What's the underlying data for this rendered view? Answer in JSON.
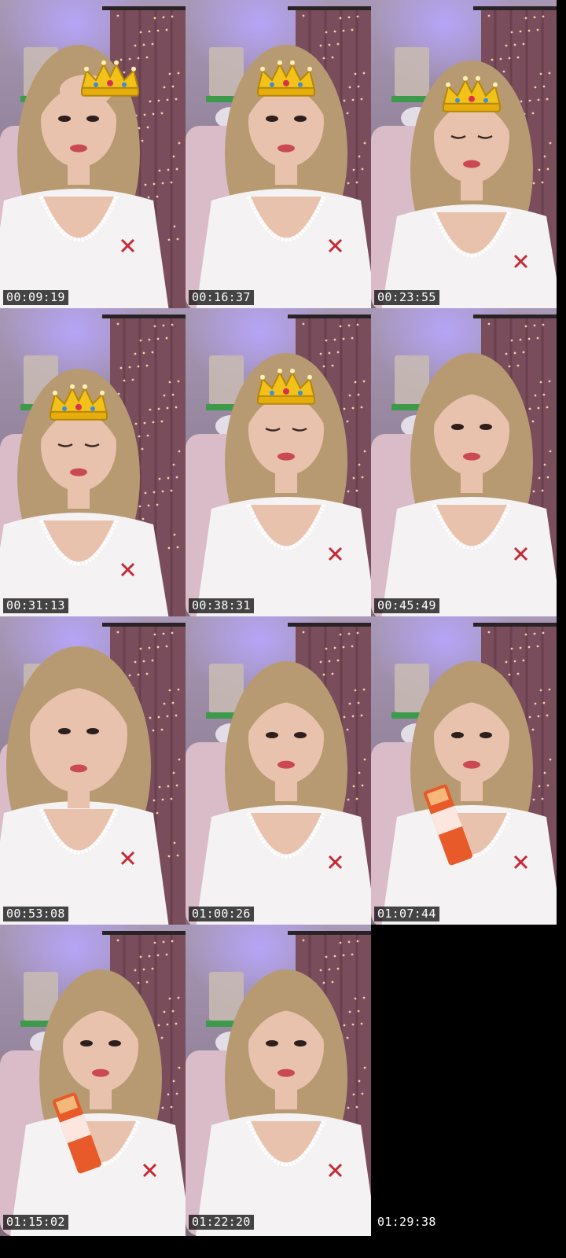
{
  "grid": {
    "columns": 3,
    "rows": 4,
    "frames": [
      {
        "timestamp": "00:09:19",
        "crown": true,
        "pose": "hand-on-head",
        "prop": ""
      },
      {
        "timestamp": "00:16:37",
        "crown": true,
        "pose": "facing",
        "prop": ""
      },
      {
        "timestamp": "00:23:55",
        "crown": true,
        "pose": "looking-down",
        "prop": ""
      },
      {
        "timestamp": "00:31:13",
        "crown": true,
        "pose": "looking-down",
        "prop": ""
      },
      {
        "timestamp": "00:38:31",
        "crown": true,
        "pose": "eyes-closed",
        "prop": ""
      },
      {
        "timestamp": "00:45:49",
        "crown": false,
        "pose": "talking",
        "prop": ""
      },
      {
        "timestamp": "00:53:08",
        "crown": false,
        "pose": "close-up",
        "prop": ""
      },
      {
        "timestamp": "01:00:26",
        "crown": false,
        "pose": "facing",
        "prop": ""
      },
      {
        "timestamp": "01:07:44",
        "crown": false,
        "pose": "eating",
        "prop": "snack-pack"
      },
      {
        "timestamp": "01:15:02",
        "crown": false,
        "pose": "eating",
        "prop": "snack-pack"
      },
      {
        "timestamp": "01:22:20",
        "crown": false,
        "pose": "facing",
        "prop": ""
      },
      {
        "timestamp": "01:29:38",
        "crown": false,
        "pose": "blank",
        "prop": ""
      }
    ]
  },
  "colors": {
    "background": "#000000",
    "wall": "#8e8196",
    "curtain": "#7a4d5c",
    "shirt": "#f4f2f2",
    "hair": "#b89a72",
    "skin": "#e9c2ad",
    "crown": "#f2c21b",
    "accent_x": "#c42a35"
  }
}
